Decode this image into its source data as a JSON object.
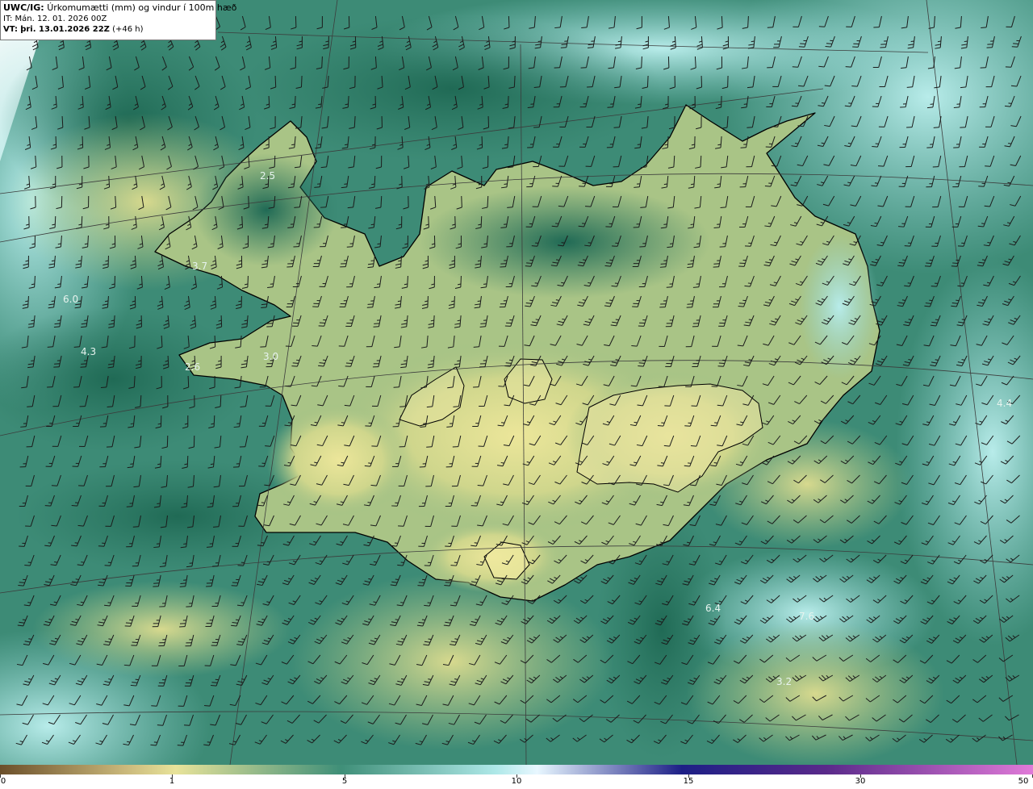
{
  "header": {
    "source": "UWC/IG:",
    "title": "Úrkomumætti (mm) og vindur í 100m hæð",
    "init_time": "IT: Mán. 12. 01. 2026 00Z",
    "valid_label": "VT:",
    "valid_time": "þri. 13.01.2026 22Z",
    "lead": "(+46 h)"
  },
  "legend": {
    "ticks": [
      "0",
      "1",
      "5",
      "10",
      "15",
      "30",
      "50"
    ],
    "colors": [
      "#6b4f2a",
      "#c9b77a",
      "#e8e39a",
      "#3f8f78",
      "#aee8e8",
      "#e8f7ff",
      "#1d1f86",
      "#5a2a8a",
      "#e07ad8"
    ]
  },
  "map": {
    "region": "Iceland",
    "colors": {
      "sea_dark": "#2a7560",
      "sea_mid": "#4c9a86",
      "sea_light": "#b7ecea",
      "land_low": "#c9d58c",
      "land_high": "#e6e394",
      "coast": "#000000",
      "barb": "#1b1b1b",
      "grid": "#3c3c3c"
    },
    "value_labels": [
      "3.7",
      "6.0",
      "4.3",
      "2.6",
      "3.0",
      "4.4",
      "6.4",
      "7.6",
      "3.2",
      "2.5"
    ]
  }
}
